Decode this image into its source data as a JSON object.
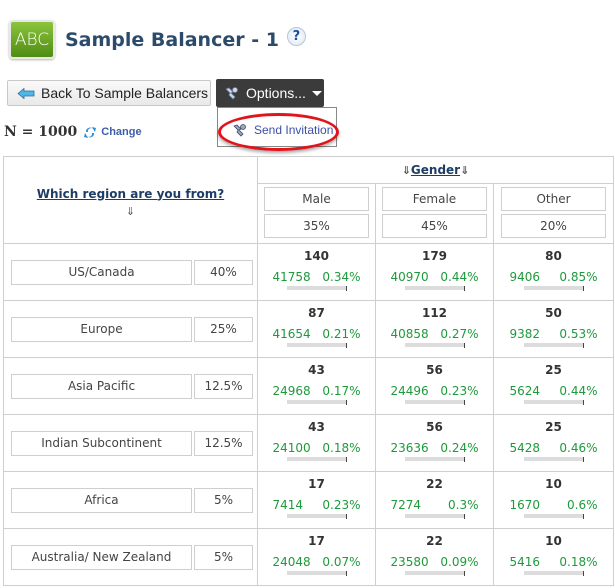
{
  "header": {
    "logo_text": "ABC",
    "title": "Sample Balancer - 1",
    "help_icon": "?"
  },
  "toolbar": {
    "back_label": "Back To Sample Balancers",
    "options_label": "Options...",
    "dropdown_items": [
      {
        "label": "Send Invitation",
        "icon": "wrench-icon",
        "highlighted": true
      }
    ]
  },
  "sample": {
    "n_label": "N = 1000",
    "change_label": "Change"
  },
  "table": {
    "row_question": "Which region are you from?",
    "row_arrow": "⇓",
    "col_question": "Gender",
    "col_arrow": "⇓",
    "columns": [
      {
        "label": "Male",
        "pct": "35%"
      },
      {
        "label": "Female",
        "pct": "45%"
      },
      {
        "label": "Other",
        "pct": "20%"
      }
    ],
    "rows": [
      {
        "region": "US/Canada",
        "pct": "40%",
        "cells": [
          {
            "count": "140",
            "available": "41758",
            "rate": "0.34%"
          },
          {
            "count": "179",
            "available": "40970",
            "rate": "0.44%"
          },
          {
            "count": "80",
            "available": "9406",
            "rate": "0.85%"
          }
        ]
      },
      {
        "region": "Europe",
        "pct": "25%",
        "cells": [
          {
            "count": "87",
            "available": "41654",
            "rate": "0.21%"
          },
          {
            "count": "112",
            "available": "40858",
            "rate": "0.27%"
          },
          {
            "count": "50",
            "available": "9382",
            "rate": "0.53%"
          }
        ]
      },
      {
        "region": "Asia Pacific",
        "pct": "12.5%",
        "cells": [
          {
            "count": "43",
            "available": "24968",
            "rate": "0.17%"
          },
          {
            "count": "56",
            "available": "24496",
            "rate": "0.23%"
          },
          {
            "count": "25",
            "available": "5624",
            "rate": "0.44%"
          }
        ]
      },
      {
        "region": "Indian Subcontinent",
        "pct": "12.5%",
        "cells": [
          {
            "count": "43",
            "available": "24100",
            "rate": "0.18%"
          },
          {
            "count": "56",
            "available": "23636",
            "rate": "0.24%"
          },
          {
            "count": "25",
            "available": "5428",
            "rate": "0.46%"
          }
        ]
      },
      {
        "region": "Africa",
        "pct": "5%",
        "cells": [
          {
            "count": "17",
            "available": "7414",
            "rate": "0.23%"
          },
          {
            "count": "22",
            "available": "7274",
            "rate": "0.3%"
          },
          {
            "count": "10",
            "available": "1670",
            "rate": "0.6%"
          }
        ]
      },
      {
        "region": "Australia/ New Zealand",
        "pct": "5%",
        "cells": [
          {
            "count": "17",
            "available": "24048",
            "rate": "0.07%"
          },
          {
            "count": "22",
            "available": "23580",
            "rate": "0.09%"
          },
          {
            "count": "10",
            "available": "5416",
            "rate": "0.18%"
          }
        ]
      }
    ]
  },
  "colors": {
    "title": "#2c4b6b",
    "options_bg": "#3b3b3b",
    "highlight_ring": "#e0141a",
    "stats_green": "#1e9a3c",
    "link_blue": "#3b5ea8"
  }
}
